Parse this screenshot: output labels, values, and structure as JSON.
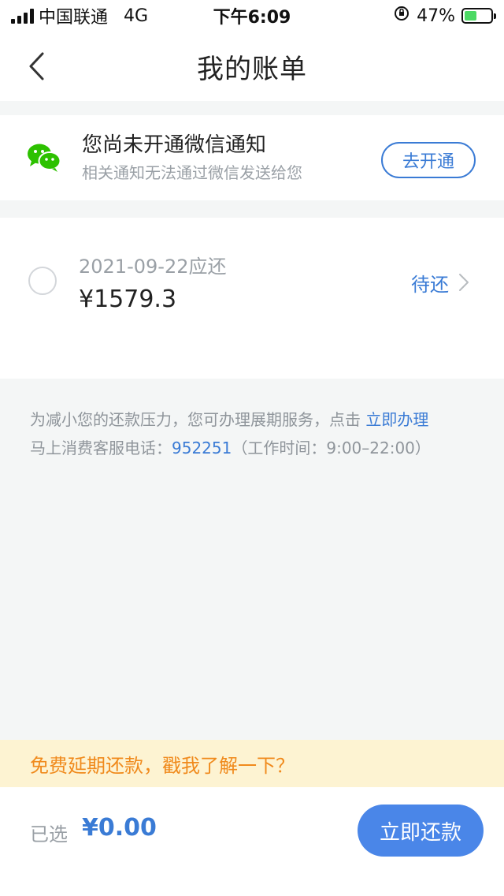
{
  "status_bar": {
    "carrier": "中国联通",
    "network": "4G",
    "time": "下午6:09",
    "battery": "47%",
    "battery_level": 0.47
  },
  "nav": {
    "title": "我的账单",
    "back_icon": "chevron-left-icon"
  },
  "wechat_notice": {
    "icon": "wechat-icon",
    "title": "您尚未开通微信通知",
    "subtitle": "相关通知无法通过微信发送给您",
    "button_label": "去开通",
    "icon_color": "#2dc100"
  },
  "bill": {
    "due_date": "2021-09-22应还",
    "amount": "¥1579.3",
    "status": "待还",
    "selected": false
  },
  "info": {
    "line1_text": "为减小您的还款压力，您可办理展期服务，点击",
    "line1_link": "立即办理",
    "line2_prefix": "马上消费客服电话：",
    "line2_phone": "952251",
    "line2_suffix": "（工作时间：9:00–22:00）"
  },
  "promo": {
    "text": "免费延期还款，戳我了解一下？"
  },
  "footer": {
    "selected_label": "已选",
    "selected_amount": "¥0.00",
    "pay_button": "立即还款"
  },
  "colors": {
    "accent": "#3a7bd5",
    "promo_text": "#f08a1c",
    "promo_bg": "#fdf3d2"
  }
}
